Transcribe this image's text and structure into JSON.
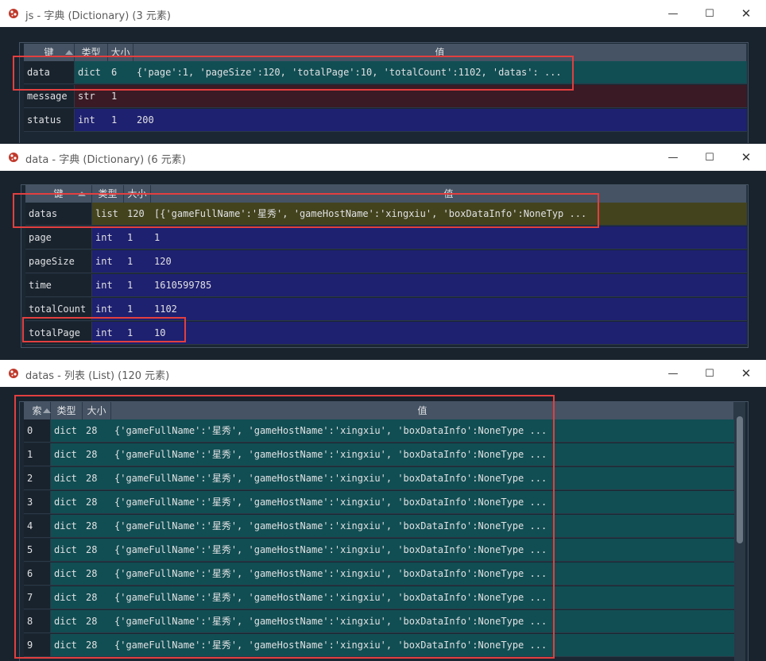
{
  "colors": {
    "teal": "#114e53",
    "maroon": "#3a1a24",
    "navy": "#1e2070",
    "olive": "#43431e",
    "highlight": "#e23f3f"
  },
  "windows": [
    {
      "title": "js - 字典 (Dictionary) (3 元素)",
      "icon": "app-icon",
      "buttons": {
        "minimize": "—",
        "maximize": "☐",
        "close": "✕"
      },
      "headers": [
        "键",
        "类型",
        "大小",
        "值"
      ],
      "rows": [
        {
          "key": "data",
          "type": "dict",
          "size": "6",
          "value": "{'page':1, 'pageSize':120, 'totalPage':10, 'totalCount':1102, 'datas': ...",
          "color": "teal"
        },
        {
          "key": "message",
          "type": "str",
          "size": "1",
          "value": "",
          "color": "maroon"
        },
        {
          "key": "status",
          "type": "int",
          "size": "1",
          "value": "200",
          "color": "navy"
        }
      ]
    },
    {
      "title": "data - 字典 (Dictionary) (6 元素)",
      "icon": "app-icon",
      "buttons": {
        "minimize": "—",
        "maximize": "☐",
        "close": "✕"
      },
      "headers": [
        "键",
        "类型",
        "大小",
        "值"
      ],
      "rows": [
        {
          "key": "datas",
          "type": "list",
          "size": "120",
          "value": "[{'gameFullName':'星秀', 'gameHostName':'xingxiu', 'boxDataInfo':NoneTyp ...",
          "color": "olive"
        },
        {
          "key": "page",
          "type": "int",
          "size": "1",
          "value": "1",
          "color": "navy"
        },
        {
          "key": "pageSize",
          "type": "int",
          "size": "1",
          "value": "120",
          "color": "navy"
        },
        {
          "key": "time",
          "type": "int",
          "size": "1",
          "value": "1610599785",
          "color": "navy"
        },
        {
          "key": "totalCount",
          "type": "int",
          "size": "1",
          "value": "1102",
          "color": "navy"
        },
        {
          "key": "totalPage",
          "type": "int",
          "size": "1",
          "value": "10",
          "color": "navy"
        }
      ]
    },
    {
      "title": "datas - 列表 (List) (120 元素)",
      "icon": "app-icon",
      "buttons": {
        "minimize": "—",
        "maximize": "☐",
        "close": "✕"
      },
      "headers": [
        "索",
        "类型",
        "大小",
        "值"
      ],
      "rows": [
        {
          "key": "0",
          "type": "dict",
          "size": "28",
          "value": "{'gameFullName':'星秀', 'gameHostName':'xingxiu', 'boxDataInfo':NoneType ...",
          "color": "teal"
        },
        {
          "key": "1",
          "type": "dict",
          "size": "28",
          "value": "{'gameFullName':'星秀', 'gameHostName':'xingxiu', 'boxDataInfo':NoneType ...",
          "color": "teal"
        },
        {
          "key": "2",
          "type": "dict",
          "size": "28",
          "value": "{'gameFullName':'星秀', 'gameHostName':'xingxiu', 'boxDataInfo':NoneType ...",
          "color": "teal"
        },
        {
          "key": "3",
          "type": "dict",
          "size": "28",
          "value": "{'gameFullName':'星秀', 'gameHostName':'xingxiu', 'boxDataInfo':NoneType ...",
          "color": "teal"
        },
        {
          "key": "4",
          "type": "dict",
          "size": "28",
          "value": "{'gameFullName':'星秀', 'gameHostName':'xingxiu', 'boxDataInfo':NoneType ...",
          "color": "teal"
        },
        {
          "key": "5",
          "type": "dict",
          "size": "28",
          "value": "{'gameFullName':'星秀', 'gameHostName':'xingxiu', 'boxDataInfo':NoneType ...",
          "color": "teal"
        },
        {
          "key": "6",
          "type": "dict",
          "size": "28",
          "value": "{'gameFullName':'星秀', 'gameHostName':'xingxiu', 'boxDataInfo':NoneType ...",
          "color": "teal"
        },
        {
          "key": "7",
          "type": "dict",
          "size": "28",
          "value": "{'gameFullName':'星秀', 'gameHostName':'xingxiu', 'boxDataInfo':NoneType ...",
          "color": "teal"
        },
        {
          "key": "8",
          "type": "dict",
          "size": "28",
          "value": "{'gameFullName':'星秀', 'gameHostName':'xingxiu', 'boxDataInfo':NoneType ...",
          "color": "teal"
        },
        {
          "key": "9",
          "type": "dict",
          "size": "28",
          "value": "{'gameFullName':'星秀', 'gameHostName':'xingxiu', 'boxDataInfo':NoneType ...",
          "color": "teal"
        }
      ]
    }
  ]
}
